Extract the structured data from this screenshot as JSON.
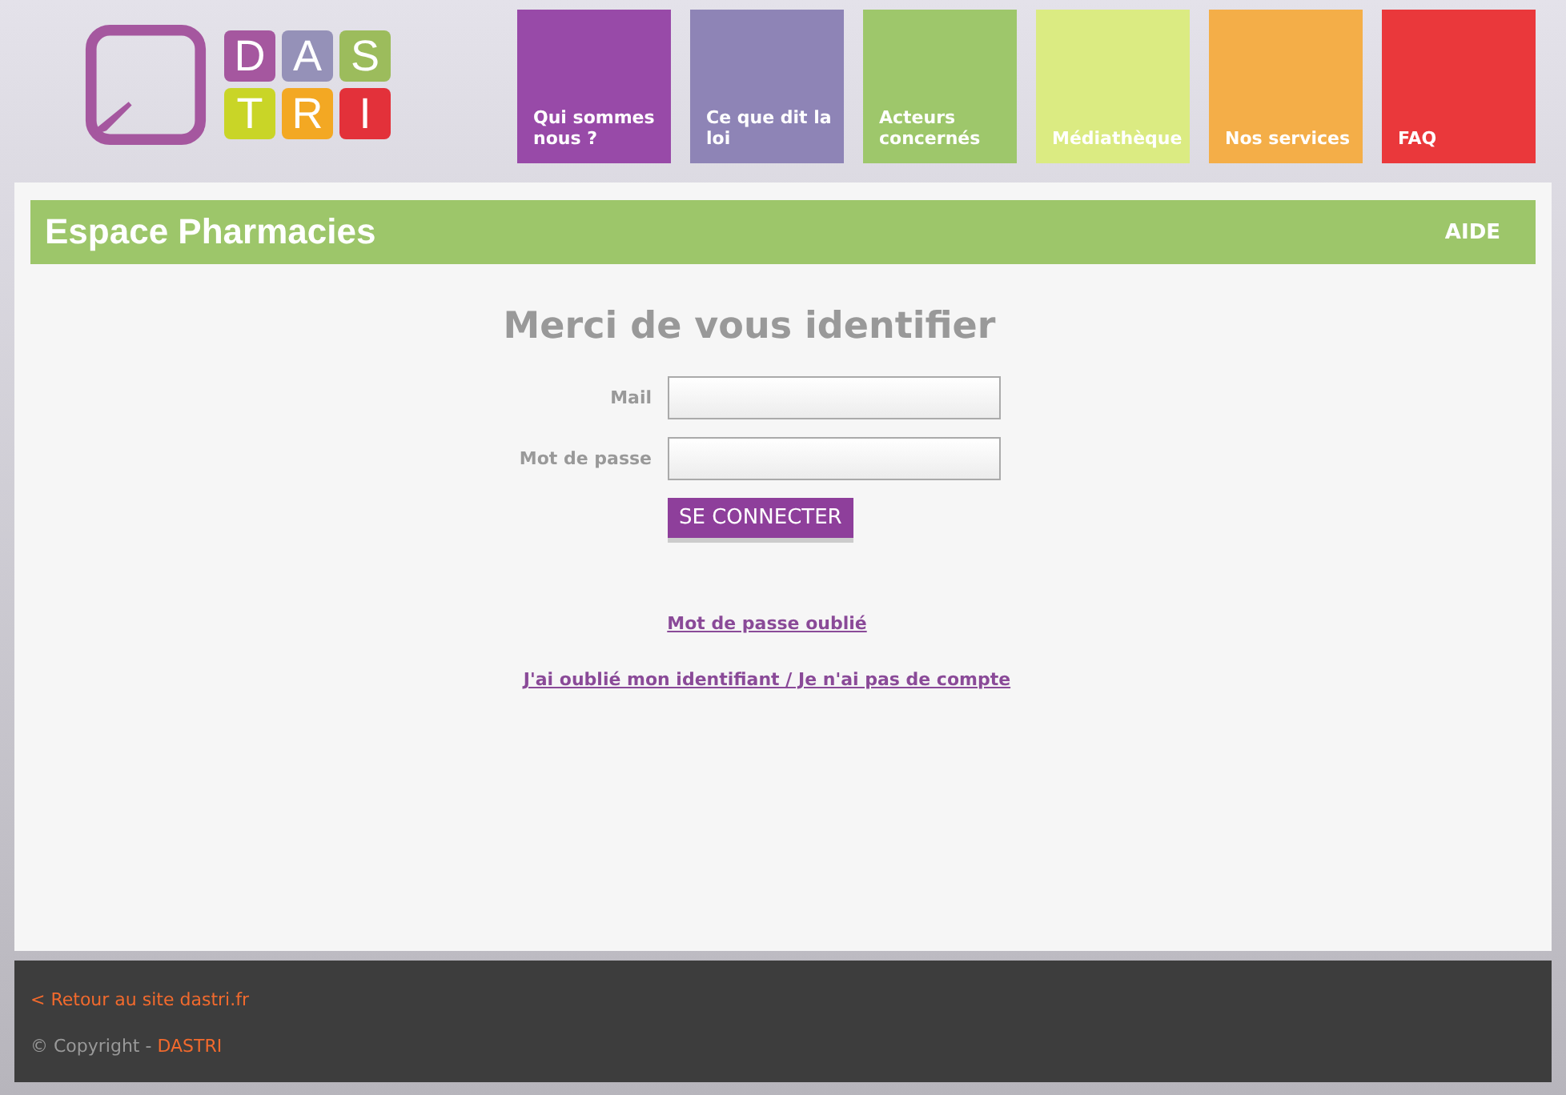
{
  "logo": {
    "tiles": [
      {
        "letter": "D",
        "color": "#a5579f"
      },
      {
        "letter": "A",
        "color": "#9591b8"
      },
      {
        "letter": "S",
        "color": "#9cbc5c"
      },
      {
        "letter": "T",
        "color": "#c9d527"
      },
      {
        "letter": "R",
        "color": "#f3a823"
      },
      {
        "letter": "I",
        "color": "#e3313a"
      }
    ]
  },
  "nav": [
    {
      "label": "Qui sommes nous ?",
      "color": "#984aa8"
    },
    {
      "label": "Ce que dit la loi",
      "color": "#8e84b6"
    },
    {
      "label": "Acteurs concernés",
      "color": "#9ec76b"
    },
    {
      "label": "Médiathèque",
      "color": "#dbeb82"
    },
    {
      "label": "Nos services",
      "color": "#f4ae48"
    },
    {
      "label": "FAQ",
      "color": "#ea383b"
    }
  ],
  "section": {
    "title": "Espace Pharmacies",
    "help": "AIDE"
  },
  "form": {
    "heading": "Merci de vous identifier",
    "fields": [
      {
        "label": "Mail"
      },
      {
        "label": "Mot de passe"
      }
    ],
    "submit": "SE CONNECTER"
  },
  "links": [
    "Mot de passe oublié",
    "J'ai oublié mon identifiant / Je n'ai pas de compte"
  ],
  "footer": {
    "back": "< Retour au site dastri.fr",
    "copyright": "© Copyright - ",
    "brand": "DASTRI"
  }
}
